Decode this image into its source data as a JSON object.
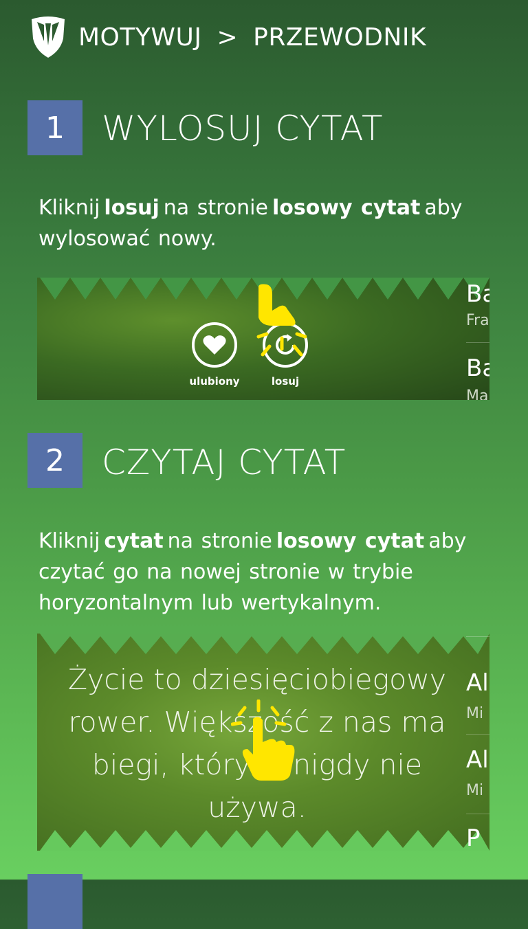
{
  "header": {
    "app_name": "MOTYWUJ",
    "separator": ">",
    "page_title": "PRZEWODNIK"
  },
  "steps": [
    {
      "number": "1",
      "title": "WYLOSUJ CYTAT",
      "desc": {
        "t1": "Kliknij",
        "b1": "losuj",
        "t2": "na stronie",
        "b2": "losowy cytat",
        "t3": "aby wylosować nowy."
      },
      "screenshot": {
        "favorite_label": "ulubiony",
        "random_label": "losuj",
        "list_items": [
          {
            "title": "Ba",
            "subtitle": "Fra"
          },
          {
            "title": "Ba",
            "subtitle": "Ma"
          }
        ]
      }
    },
    {
      "number": "2",
      "title": "CZYTAJ CYTAT",
      "desc": {
        "t1": "Kliknij",
        "b1": "cytat",
        "t2": "na stronie",
        "b2": "losowy cytat",
        "t3": "aby czytać go na nowej stronie w trybie horyzontalnym lub wertykalnym."
      },
      "screenshot": {
        "quote": "Życie to dziesięciobiegowy rower. Większość z nas ma biegi, których nigdy nie używa.",
        "list_items": [
          {
            "title": "Al",
            "subtitle": "Mi"
          },
          {
            "title": "Al",
            "subtitle": "Mi"
          },
          {
            "title": "P",
            "subtitle": ""
          }
        ]
      }
    }
  ],
  "colors": {
    "step_badge": "#5670a8",
    "hand": "#ffe600",
    "bg_top": "#2b5a2f",
    "bg_bottom": "#69cf60"
  }
}
